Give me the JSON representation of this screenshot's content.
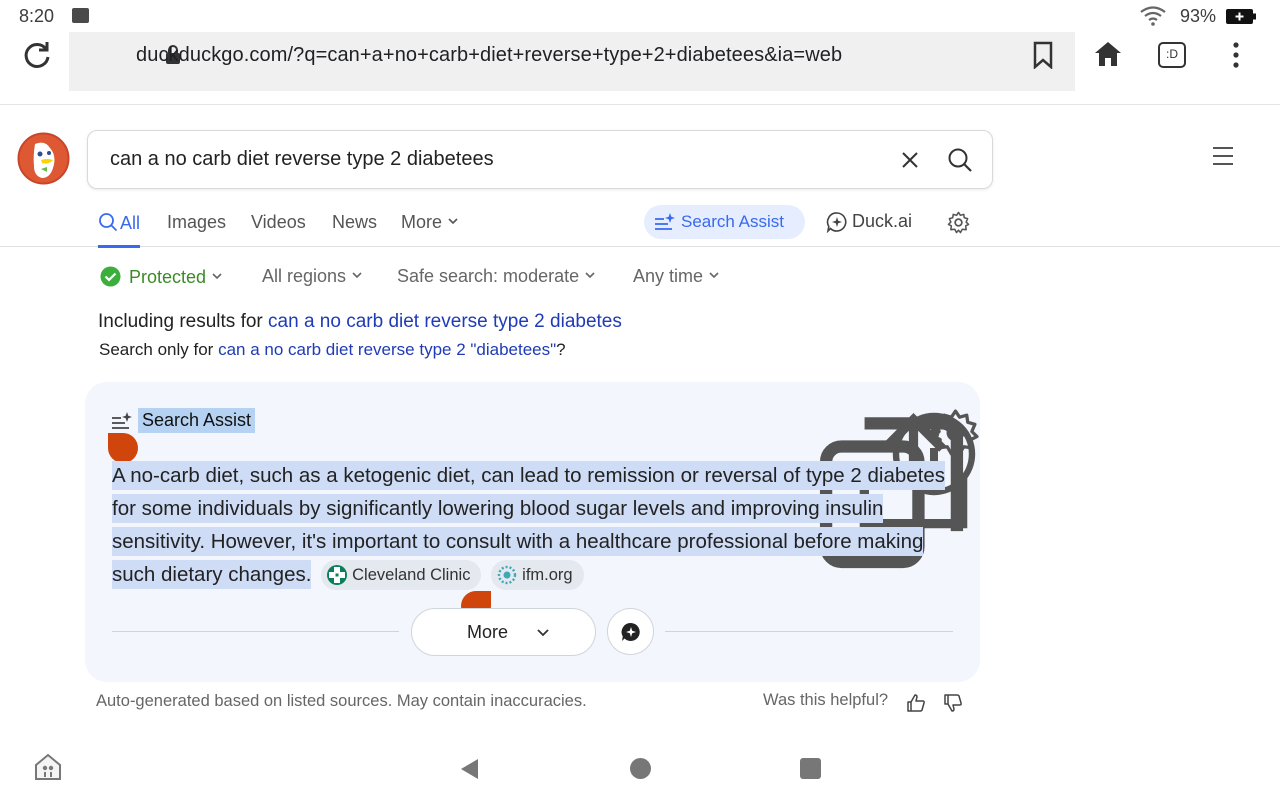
{
  "status": {
    "time": "8:20",
    "battery": "93%"
  },
  "browser": {
    "url": "duckduckgo.com/?q=can+a+no+carb+diet+reverse+type+2+diabetees&ia=web",
    "tabs_badge": ":D"
  },
  "search": {
    "query": "can a no carb diet reverse type 2 diabetees"
  },
  "tabs": {
    "all": "All",
    "images": "Images",
    "videos": "Videos",
    "news": "News",
    "more": "More",
    "search_assist": "Search Assist",
    "duck_ai": "Duck.ai"
  },
  "filters": {
    "protected": "Protected",
    "regions": "All regions",
    "safe_search": "Safe search: moderate",
    "time": "Any time"
  },
  "spelling": {
    "including_prefix": "Including results for ",
    "including_link": "can a no carb diet reverse type 2 diabetes",
    "search_only_prefix": "Search only for ",
    "search_only_link": "can a no carb diet reverse type 2 \"diabetees\"",
    "search_only_suffix": "?"
  },
  "assist": {
    "title": "Search Assist",
    "answer": "A no-carb diet, such as a ketogenic diet, can lead to remission or reversal of type 2 diabetes for some individuals by significantly lowering blood sugar levels and improving insulin sensitivity. However, it's important to consult with a healthcare professional before making such dietary changes.",
    "sources": [
      {
        "name": "Cleveland Clinic"
      },
      {
        "name": "ifm.org"
      }
    ],
    "more_label": "More",
    "disclaimer": "Auto-generated based on listed sources. May contain inaccuracies.",
    "helpful": "Was this helpful?"
  },
  "colors": {
    "accent": "#3969ef",
    "link": "#1f3bb6",
    "protected": "#3b8a26",
    "card_bg": "#f3f6fd",
    "selection": "#cfdcf6",
    "handle": "#d0450c"
  }
}
